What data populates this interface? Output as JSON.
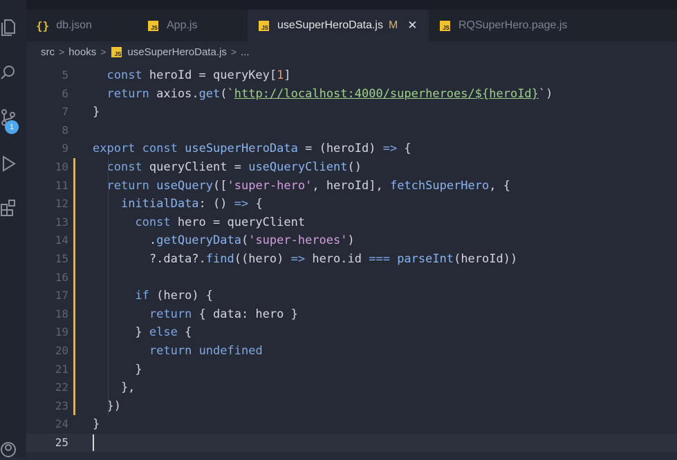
{
  "tabs": [
    {
      "icon": "{}",
      "label": "db.json",
      "modified": "",
      "active": false
    },
    {
      "icon": "JS",
      "label": "App.js",
      "modified": "",
      "active": false
    },
    {
      "icon": "JS",
      "label": "useSuperHeroData.js",
      "modified": "M",
      "active": true
    },
    {
      "icon": "JS",
      "label": "RQSuperHero.page.js",
      "modified": "",
      "active": false
    }
  ],
  "close_glyph": "✕",
  "breadcrumb": [
    "src",
    "hooks",
    "useSuperHeroData.js",
    "..."
  ],
  "scm_badge": "1",
  "lines": [
    {
      "n": "5",
      "tokens": [
        [
          "plain",
          "  "
        ],
        [
          "kw",
          "const"
        ],
        [
          "plain",
          " heroId = queryKey["
        ],
        [
          "num",
          "1"
        ],
        [
          "plain",
          "]"
        ]
      ]
    },
    {
      "n": "6",
      "tokens": [
        [
          "plain",
          "  "
        ],
        [
          "kw",
          "return"
        ],
        [
          "plain",
          " axios."
        ],
        [
          "fn",
          "get"
        ],
        [
          "plain",
          "(`"
        ],
        [
          "url",
          "http://localhost:4000/superheroes/"
        ],
        [
          "url",
          "${"
        ],
        [
          "url",
          "heroId"
        ],
        [
          "url",
          "}"
        ],
        [
          "plain",
          "`)"
        ]
      ]
    },
    {
      "n": "7",
      "tokens": [
        [
          "plain",
          "}"
        ]
      ]
    },
    {
      "n": "8",
      "tokens": []
    },
    {
      "n": "9",
      "tokens": [
        [
          "kw",
          "export"
        ],
        [
          "plain",
          " "
        ],
        [
          "kw",
          "const"
        ],
        [
          "plain",
          " "
        ],
        [
          "fn",
          "useSuperHeroData"
        ],
        [
          "plain",
          " = (heroId) "
        ],
        [
          "kw",
          "=>"
        ],
        [
          "plain",
          " {"
        ]
      ]
    },
    {
      "n": "10",
      "tokens": [
        [
          "plain",
          "  "
        ],
        [
          "kw",
          "const"
        ],
        [
          "plain",
          " queryClient = "
        ],
        [
          "fn",
          "useQueryClient"
        ],
        [
          "plain",
          "()"
        ]
      ]
    },
    {
      "n": "11",
      "tokens": [
        [
          "plain",
          "  "
        ],
        [
          "kw",
          "return"
        ],
        [
          "plain",
          " "
        ],
        [
          "fn",
          "useQuery"
        ],
        [
          "plain",
          "(["
        ],
        [
          "str",
          "'super-hero'"
        ],
        [
          "plain",
          ", heroId], "
        ],
        [
          "fn",
          "fetchSuperHero"
        ],
        [
          "plain",
          ", {"
        ]
      ]
    },
    {
      "n": "12",
      "tokens": [
        [
          "plain",
          "    "
        ],
        [
          "fn",
          "initialData"
        ],
        [
          "plain",
          ": () "
        ],
        [
          "kw",
          "=>"
        ],
        [
          "plain",
          " {"
        ]
      ]
    },
    {
      "n": "13",
      "tokens": [
        [
          "plain",
          "      "
        ],
        [
          "kw",
          "const"
        ],
        [
          "plain",
          " hero = queryClient"
        ]
      ]
    },
    {
      "n": "14",
      "tokens": [
        [
          "plain",
          "        ."
        ],
        [
          "fn",
          "getQueryData"
        ],
        [
          "plain",
          "("
        ],
        [
          "str",
          "'super-heroes'"
        ],
        [
          "plain",
          ")"
        ]
      ]
    },
    {
      "n": "15",
      "tokens": [
        [
          "plain",
          "        ?.data?."
        ],
        [
          "fn",
          "find"
        ],
        [
          "plain",
          "((hero) "
        ],
        [
          "kw",
          "=>"
        ],
        [
          "plain",
          " hero.id "
        ],
        [
          "kw",
          "==="
        ],
        [
          "plain",
          " "
        ],
        [
          "fn",
          "parseInt"
        ],
        [
          "plain",
          "(heroId))"
        ]
      ]
    },
    {
      "n": "16",
      "tokens": []
    },
    {
      "n": "17",
      "tokens": [
        [
          "plain",
          "      "
        ],
        [
          "kw",
          "if"
        ],
        [
          "plain",
          " (hero) {"
        ]
      ]
    },
    {
      "n": "18",
      "tokens": [
        [
          "plain",
          "        "
        ],
        [
          "kw",
          "return"
        ],
        [
          "plain",
          " { data: hero }"
        ]
      ]
    },
    {
      "n": "19",
      "tokens": [
        [
          "plain",
          "      } "
        ],
        [
          "kw",
          "else"
        ],
        [
          "plain",
          " {"
        ]
      ]
    },
    {
      "n": "20",
      "tokens": [
        [
          "plain",
          "        "
        ],
        [
          "kw",
          "return"
        ],
        [
          "plain",
          " "
        ],
        [
          "kw",
          "undefined"
        ]
      ]
    },
    {
      "n": "21",
      "tokens": [
        [
          "plain",
          "      }"
        ]
      ]
    },
    {
      "n": "22",
      "tokens": [
        [
          "plain",
          "    },"
        ]
      ]
    },
    {
      "n": "23",
      "tokens": [
        [
          "plain",
          "  })"
        ]
      ]
    },
    {
      "n": "24",
      "tokens": [
        [
          "plain",
          "}"
        ]
      ]
    },
    {
      "n": "25",
      "tokens": [],
      "current": true
    }
  ],
  "colors": {
    "keyword": "#7fa7e3",
    "function": "#8ab4f0",
    "string": "#d49ee0",
    "number": "#e59b74",
    "url": "#9fd28a",
    "modified_gutter": "#d8b26a"
  },
  "icons": [
    "files-icon",
    "search-icon",
    "source-control-icon",
    "run-debug-icon",
    "extensions-icon",
    "account-icon"
  ]
}
